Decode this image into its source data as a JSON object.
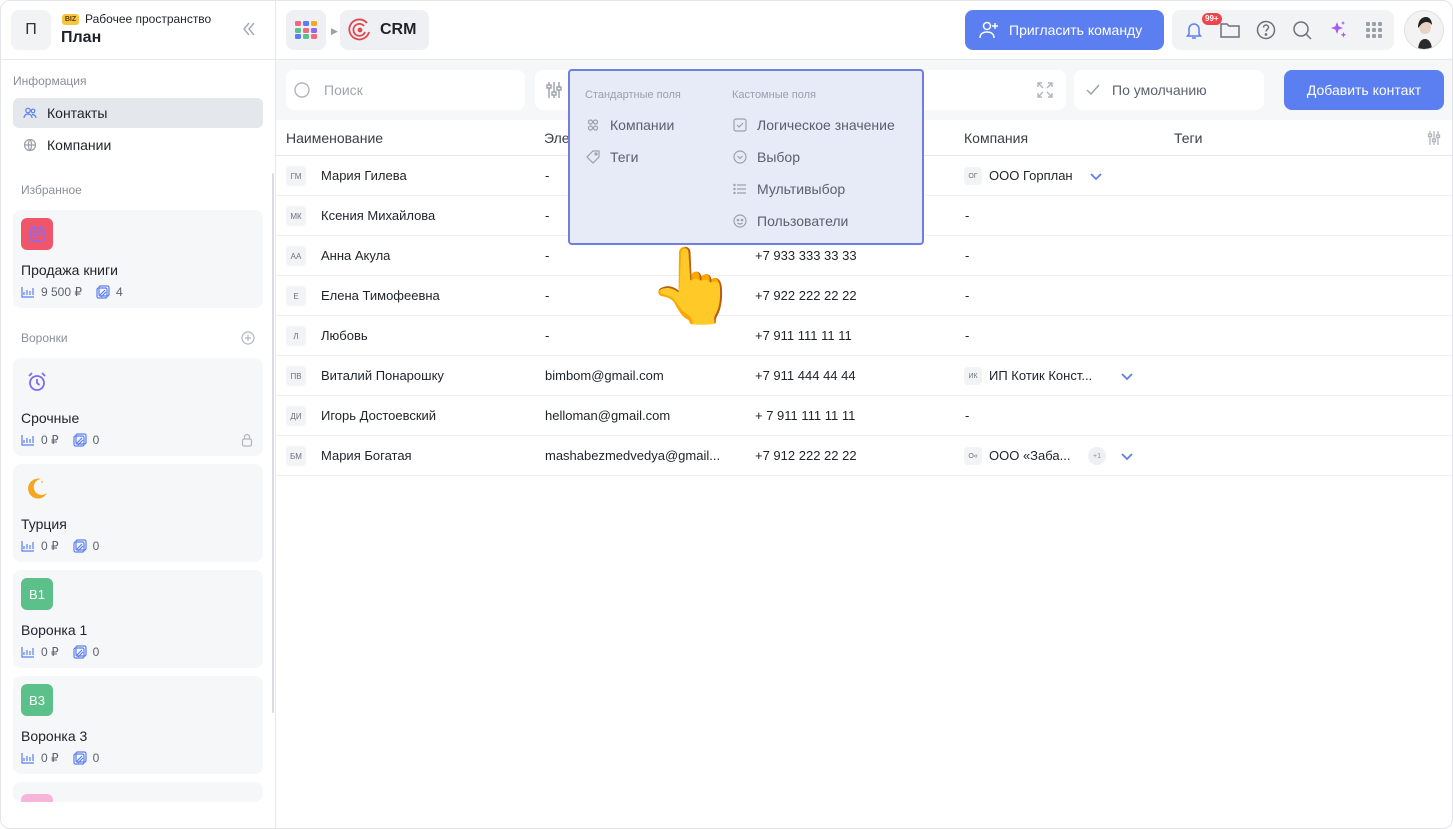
{
  "workspace": {
    "avatar_letter": "П",
    "badge": "BIZ",
    "label": "Рабочее пространство",
    "name": "План"
  },
  "sidebar": {
    "info_title": "Информация",
    "nav": [
      {
        "label": "Контакты",
        "icon": "contacts-icon",
        "active": true
      },
      {
        "label": "Компании",
        "icon": "companies-icon",
        "active": false
      }
    ],
    "favorites_title": "Избранное",
    "favorites": [
      {
        "title": "Продажа книги",
        "amount": "9 500 ₽",
        "count": "4",
        "badge_color": "#f0566a"
      }
    ],
    "funnels_title": "Воронки",
    "funnels": [
      {
        "title": "Срочные",
        "amount": "0 ₽",
        "count": "0",
        "icon": "alarm-clock-icon",
        "locked": true
      },
      {
        "title": "Турция",
        "amount": "0 ₽",
        "count": "0",
        "icon": "crescent-moon-icon"
      },
      {
        "title": "Воронка 1",
        "badge": "В1",
        "amount": "0 ₽",
        "count": "0",
        "badge_color": "#5cc08a"
      },
      {
        "title": "Воронка 3",
        "badge": "В3",
        "amount": "0 ₽",
        "count": "0",
        "badge_color": "#5cc08a"
      }
    ]
  },
  "topbar": {
    "module": "CRM",
    "invite_label": "Пригласить команду",
    "notifications_badge": "99+",
    "accent": "#5b7ff0"
  },
  "toolbar": {
    "search_placeholder": "Поиск",
    "view_label": "По умолчанию",
    "add_contact_label": "Добавить контакт"
  },
  "table": {
    "headers": {
      "name": "Наименование",
      "email": "Эле",
      "company": "Компания",
      "tags": "Теги"
    },
    "rows": [
      {
        "initials": "ГМ",
        "name": "Мария Гилева",
        "email": "-",
        "phone": "",
        "company_initials": "ОГ",
        "company": "ООО Горплан",
        "extra": "",
        "expand": true
      },
      {
        "initials": "МК",
        "name": "Ксения Михайлова",
        "email": "-",
        "phone": "",
        "company_initials": "",
        "company": "-",
        "extra": "",
        "expand": false
      },
      {
        "initials": "АА",
        "name": "Анна Акула",
        "email": "-",
        "phone": "+7 933 333 33 33",
        "company_initials": "",
        "company": "-",
        "extra": "",
        "expand": false
      },
      {
        "initials": "Е",
        "name": "Елена Тимофеевна",
        "email": "-",
        "phone": "+7 922 222 22 22",
        "company_initials": "",
        "company": "-",
        "extra": "",
        "expand": false
      },
      {
        "initials": "Л",
        "name": "Любовь",
        "email": "-",
        "phone": "+7 911 111 11 11",
        "company_initials": "",
        "company": "-",
        "extra": "",
        "expand": false
      },
      {
        "initials": "ПВ",
        "name": "Виталий Понарошку",
        "email": "bimbom@gmail.com",
        "phone": "+7 911 444 44 44",
        "company_initials": "ИК",
        "company": "ИП Котик Конст...",
        "extra": "",
        "expand": true
      },
      {
        "initials": "ДИ",
        "name": "Игорь Достоевский",
        "email": "helloman@gmail.com",
        "phone": "+ 7 911 111 11 11",
        "company_initials": "",
        "company": "-",
        "extra": "",
        "expand": false
      },
      {
        "initials": "БМ",
        "name": "Мария Богатая",
        "email": "mashabezmedvedya@gmail...",
        "phone": "+7 912 222 22 22",
        "company_initials": "О«",
        "company": "ООО «Заба...",
        "extra": "+1",
        "expand": true
      }
    ]
  },
  "popover": {
    "standard_title": "Стандартные поля",
    "custom_title": "Кастомные поля",
    "standard": [
      {
        "label": "Компании",
        "icon": "companies-icon"
      },
      {
        "label": "Теги",
        "icon": "tag-icon"
      }
    ],
    "custom": [
      {
        "label": "Логическое значение",
        "icon": "checkbox-icon"
      },
      {
        "label": "Выбор",
        "icon": "select-icon"
      },
      {
        "label": "Мультивыбор",
        "icon": "list-icon"
      },
      {
        "label": "Пользователи",
        "icon": "users-icon"
      }
    ]
  },
  "pointer": "👆"
}
